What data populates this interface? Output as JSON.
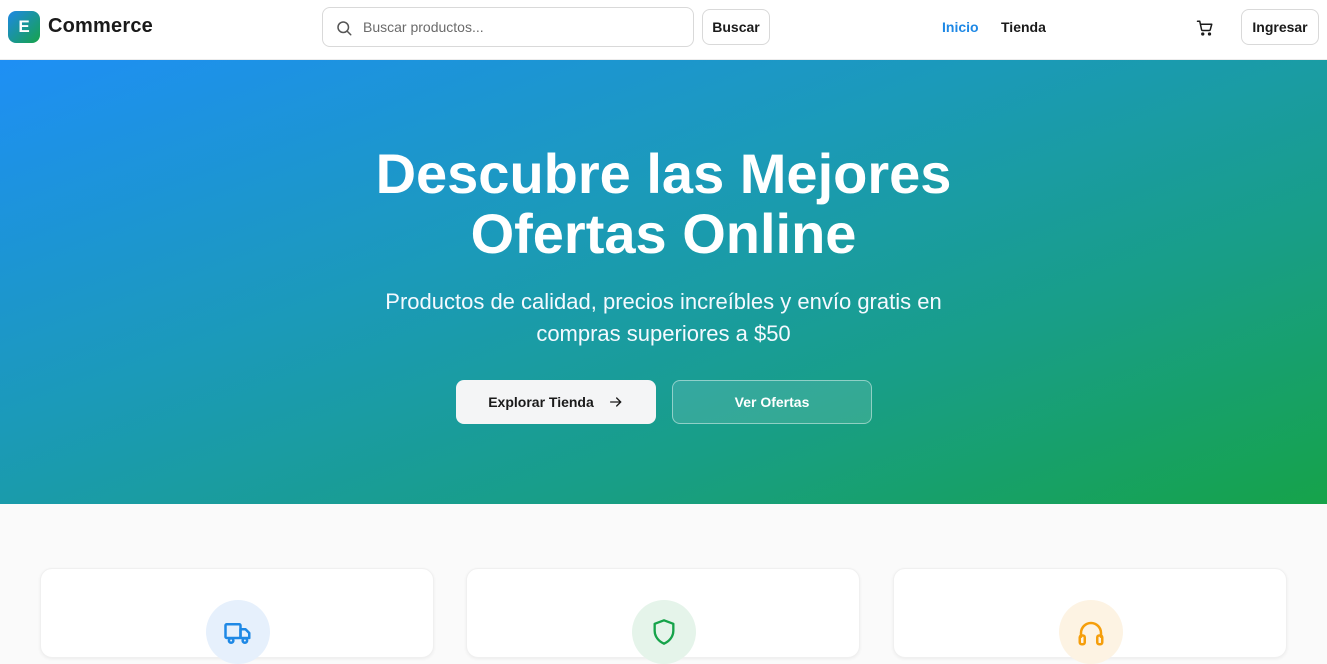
{
  "brand": {
    "badge_letter": "E",
    "name": "Commerce"
  },
  "search": {
    "placeholder": "Buscar productos...",
    "button_label": "Buscar"
  },
  "nav": {
    "items": [
      {
        "label": "Inicio",
        "active": true
      },
      {
        "label": "Tienda",
        "active": false
      }
    ]
  },
  "header_actions": {
    "cart_icon": "shopping-cart-icon",
    "login_label": "Ingresar"
  },
  "hero": {
    "title_line1": "Descubre las Mejores",
    "title_line2": "Ofertas Online",
    "subtitle_line1": "Productos de calidad, precios increíbles y envío gratis en",
    "subtitle_line2": "compras superiores a $50",
    "primary_button": "Explorar Tienda",
    "secondary_button": "Ver Ofertas"
  },
  "features": [
    {
      "icon": "truck-icon",
      "color": "#1e88e5"
    },
    {
      "icon": "shield-icon",
      "color": "#16a34a"
    },
    {
      "icon": "headphones-icon",
      "color": "#f59e0b"
    }
  ],
  "colors": {
    "accent": "#1e88e5",
    "hero_start": "#1e8ff5",
    "hero_end": "#16a34a"
  }
}
